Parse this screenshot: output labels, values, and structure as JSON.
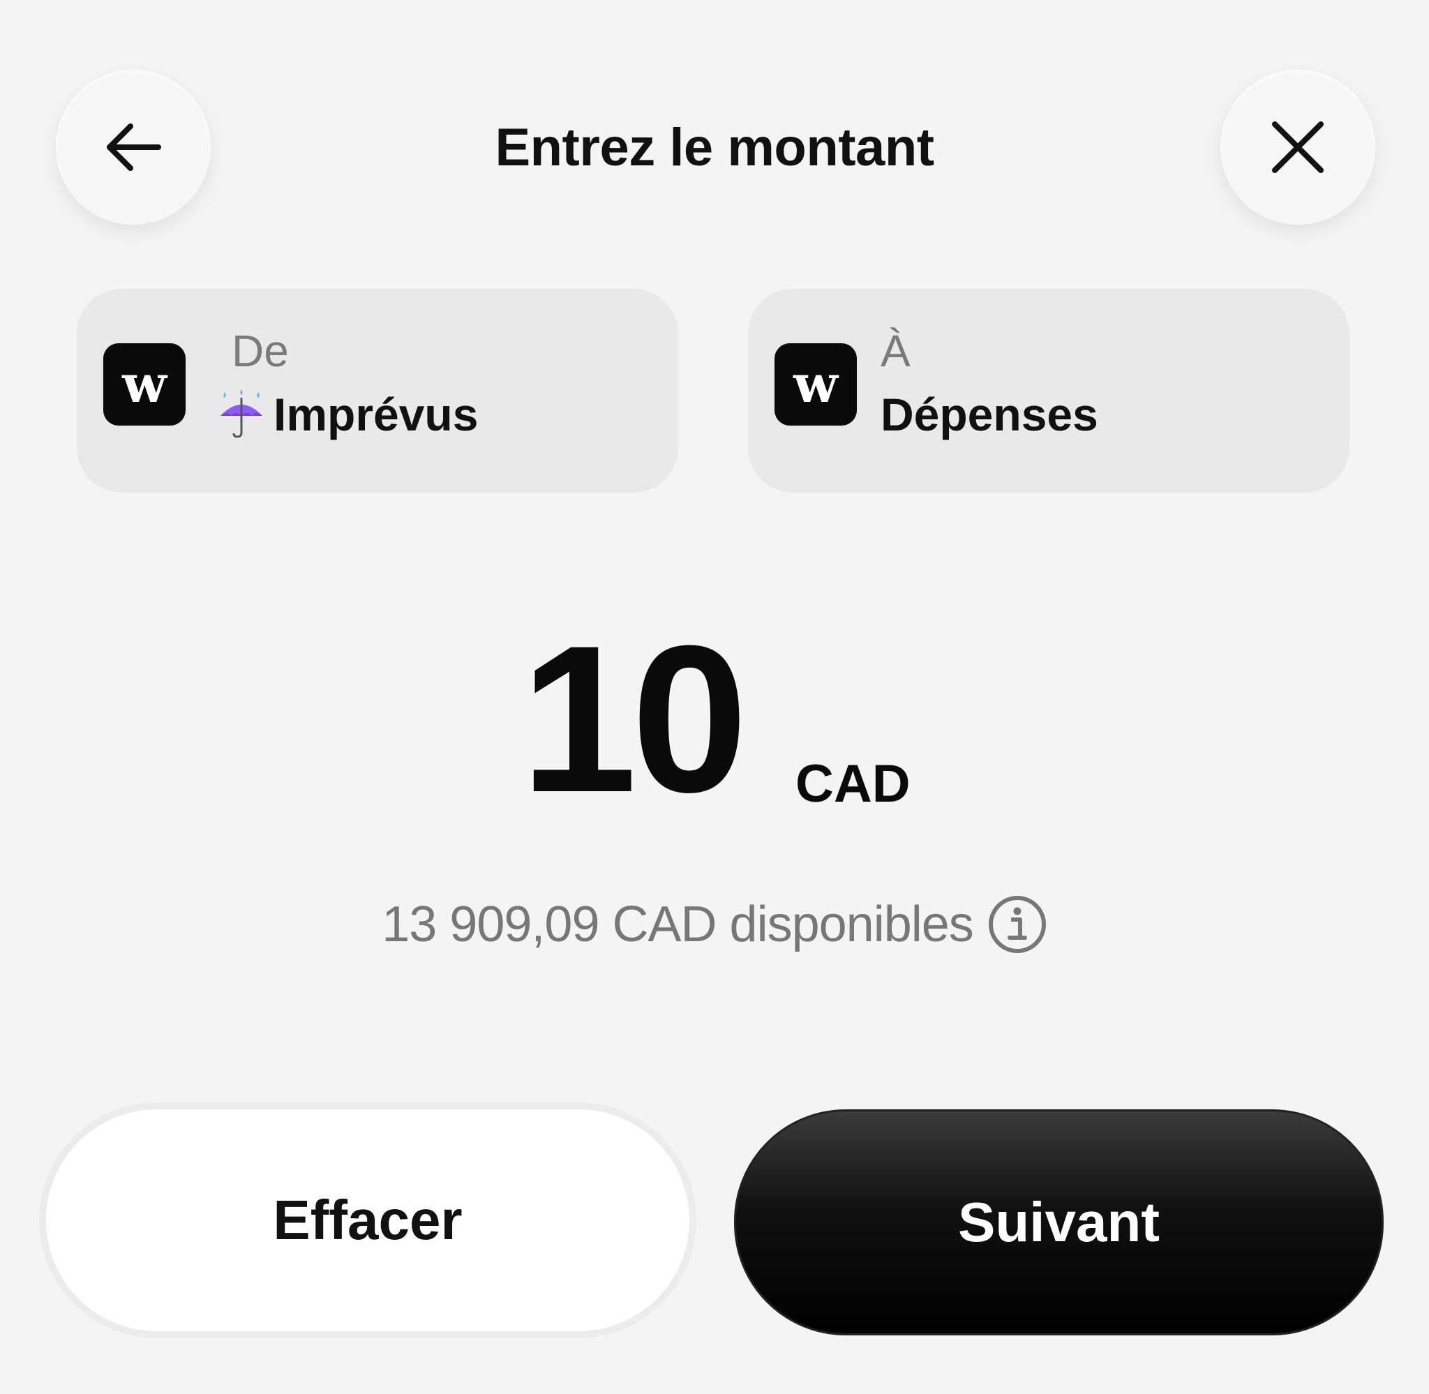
{
  "header": {
    "title": "Entrez le montant",
    "back_icon": "arrow-left-icon",
    "close_icon": "close-icon"
  },
  "transfer": {
    "from": {
      "label": "De",
      "logo_letter": "w",
      "emoji_icon": "umbrella-with-rain-icon",
      "name": "Imprévus"
    },
    "to": {
      "label": "À",
      "logo_letter": "w",
      "name": "Dépenses"
    }
  },
  "amount": {
    "value": "10",
    "currency": "CAD"
  },
  "balance": {
    "text": "13 909,09 CAD disponibles",
    "info_icon": "info-icon"
  },
  "actions": {
    "clear_label": "Effacer",
    "next_label": "Suivant"
  },
  "colors": {
    "background": "#f4f4f4",
    "card": "#e9e9e9",
    "primary_button": "#000000",
    "muted_text": "#777777"
  }
}
